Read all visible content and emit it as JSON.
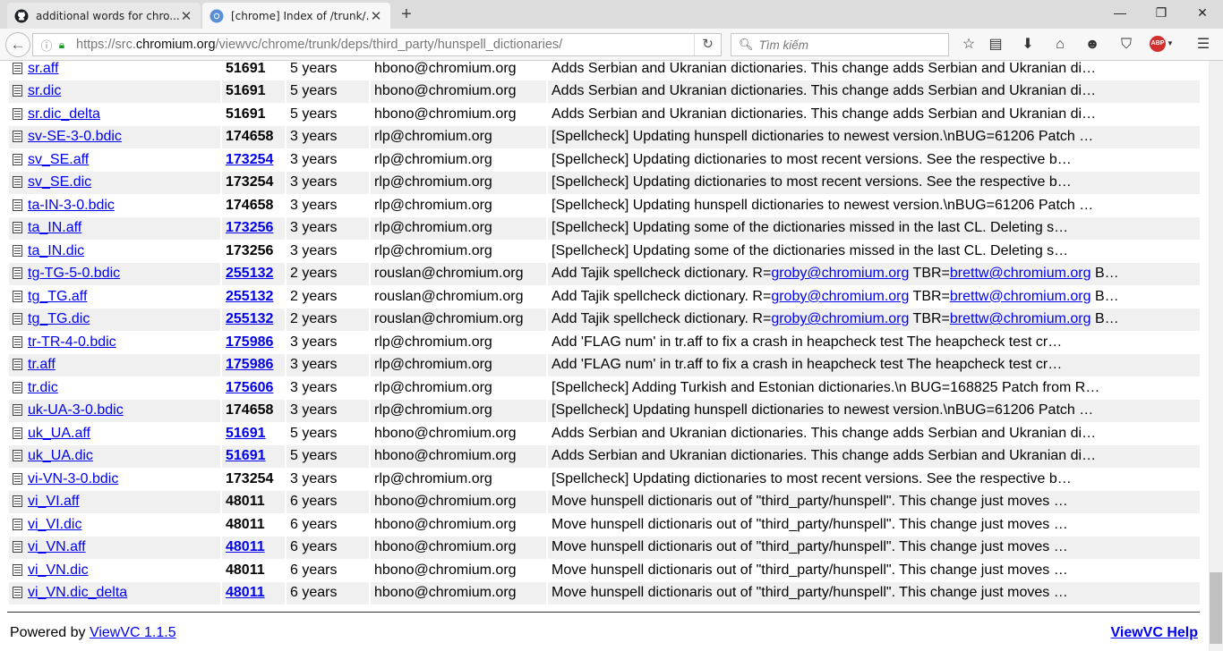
{
  "tabs": [
    {
      "title": "additional words for chro..."
    },
    {
      "title": "[chrome] Index of /trunk/..."
    }
  ],
  "navbar": {
    "url_prefix": "https://src.",
    "url_domain": "chromium.org",
    "url_path": "/viewvc/chrome/trunk/deps/third_party/hunspell_dictionaries/",
    "search_placeholder": "Tìm kiếm",
    "adblock_label": "ABP"
  },
  "colors": {
    "link": "#0000ee",
    "row_alt": "#f0f0f0",
    "secure_lock": "#1a9a2c",
    "adblock": "#d32f2f"
  },
  "rows": [
    {
      "name": "sr.aff",
      "rev": "51691",
      "rev_link": false,
      "age": "5 years",
      "author": "hbono@chromium.org",
      "log": "Adds Serbian and Ukranian dictionaries. This change adds Serbian and Ukranian di…"
    },
    {
      "name": "sr.dic",
      "rev": "51691",
      "rev_link": false,
      "age": "5 years",
      "author": "hbono@chromium.org",
      "log": "Adds Serbian and Ukranian dictionaries. This change adds Serbian and Ukranian di…"
    },
    {
      "name": "sr.dic_delta",
      "rev": "51691",
      "rev_link": false,
      "age": "5 years",
      "author": "hbono@chromium.org",
      "log": "Adds Serbian and Ukranian dictionaries. This change adds Serbian and Ukranian di…"
    },
    {
      "name": "sv-SE-3-0.bdic",
      "rev": "174658",
      "rev_link": false,
      "age": "3 years",
      "author": "rlp@chromium.org",
      "log": "[Spellcheck] Updating hunspell dictionaries to newest version.\\nBUG=61206 Patch …"
    },
    {
      "name": "sv_SE.aff",
      "rev": "173254",
      "rev_link": true,
      "age": "3 years",
      "author": "rlp@chromium.org",
      "log": "[Spellcheck] Updating dictionaries to most recent versions. See the respective b…"
    },
    {
      "name": "sv_SE.dic",
      "rev": "173254",
      "rev_link": false,
      "age": "3 years",
      "author": "rlp@chromium.org",
      "log": "[Spellcheck] Updating dictionaries to most recent versions. See the respective b…"
    },
    {
      "name": "ta-IN-3-0.bdic",
      "rev": "174658",
      "rev_link": false,
      "age": "3 years",
      "author": "rlp@chromium.org",
      "log": "[Spellcheck] Updating hunspell dictionaries to newest version.\\nBUG=61206 Patch …"
    },
    {
      "name": "ta_IN.aff",
      "rev": "173256",
      "rev_link": true,
      "age": "3 years",
      "author": "rlp@chromium.org",
      "log": "[Spellcheck] Updating some of the dictionaries missed in the last CL. Deleting s…"
    },
    {
      "name": "ta_IN.dic",
      "rev": "173256",
      "rev_link": false,
      "age": "3 years",
      "author": "rlp@chromium.org",
      "log": "[Spellcheck] Updating some of the dictionaries missed in the last CL. Deleting s…"
    },
    {
      "name": "tg-TG-5-0.bdic",
      "rev": "255132",
      "rev_link": true,
      "age": "2 years",
      "author": "rouslan@chromium.org",
      "log_pre": "Add Tajik spellcheck dictionary. R=",
      "log_l1": "groby@chromium.org",
      "log_mid": " TBR=",
      "log_l2": "brettw@chromium.org",
      "log_post": " B…"
    },
    {
      "name": "tg_TG.aff",
      "rev": "255132",
      "rev_link": true,
      "age": "2 years",
      "author": "rouslan@chromium.org",
      "log_pre": "Add Tajik spellcheck dictionary. R=",
      "log_l1": "groby@chromium.org",
      "log_mid": " TBR=",
      "log_l2": "brettw@chromium.org",
      "log_post": " B…"
    },
    {
      "name": "tg_TG.dic",
      "rev": "255132",
      "rev_link": true,
      "age": "2 years",
      "author": "rouslan@chromium.org",
      "log_pre": "Add Tajik spellcheck dictionary. R=",
      "log_l1": "groby@chromium.org",
      "log_mid": " TBR=",
      "log_l2": "brettw@chromium.org",
      "log_post": " B…"
    },
    {
      "name": "tr-TR-4-0.bdic",
      "rev": "175986",
      "rev_link": true,
      "age": "3 years",
      "author": "rlp@chromium.org",
      "log": "Add 'FLAG num' in tr.aff to fix a crash in heapcheck test The heapcheck test cr…"
    },
    {
      "name": "tr.aff",
      "rev": "175986",
      "rev_link": true,
      "age": "3 years",
      "author": "rlp@chromium.org",
      "log": "Add 'FLAG num' in tr.aff to fix a crash in heapcheck test The heapcheck test cr…"
    },
    {
      "name": "tr.dic",
      "rev": "175606",
      "rev_link": true,
      "age": "3 years",
      "author": "rlp@chromium.org",
      "log": "[Spellcheck] Adding Turkish and Estonian dictionaries.\\n BUG=168825 Patch from R…"
    },
    {
      "name": "uk-UA-3-0.bdic",
      "rev": "174658",
      "rev_link": false,
      "age": "3 years",
      "author": "rlp@chromium.org",
      "log": "[Spellcheck] Updating hunspell dictionaries to newest version.\\nBUG=61206 Patch …"
    },
    {
      "name": "uk_UA.aff",
      "rev": "51691",
      "rev_link": true,
      "age": "5 years",
      "author": "hbono@chromium.org",
      "log": "Adds Serbian and Ukranian dictionaries. This change adds Serbian and Ukranian di…"
    },
    {
      "name": "uk_UA.dic",
      "rev": "51691",
      "rev_link": true,
      "age": "5 years",
      "author": "hbono@chromium.org",
      "log": "Adds Serbian and Ukranian dictionaries. This change adds Serbian and Ukranian di…"
    },
    {
      "name": "vi-VN-3-0.bdic",
      "rev": "173254",
      "rev_link": false,
      "age": "3 years",
      "author": "rlp@chromium.org",
      "log": "[Spellcheck] Updating dictionaries to most recent versions. See the respective b…"
    },
    {
      "name": "vi_VI.aff",
      "rev": "48011",
      "rev_link": false,
      "age": "6 years",
      "author": "hbono@chromium.org",
      "log": "Move hunspell dictionaris out of \"third_party/hunspell\". This change just moves …"
    },
    {
      "name": "vi_VI.dic",
      "rev": "48011",
      "rev_link": false,
      "age": "6 years",
      "author": "hbono@chromium.org",
      "log": "Move hunspell dictionaris out of \"third_party/hunspell\". This change just moves …"
    },
    {
      "name": "vi_VN.aff",
      "rev": "48011",
      "rev_link": true,
      "age": "6 years",
      "author": "hbono@chromium.org",
      "log": "Move hunspell dictionaris out of \"third_party/hunspell\". This change just moves …"
    },
    {
      "name": "vi_VN.dic",
      "rev": "48011",
      "rev_link": false,
      "age": "6 years",
      "author": "hbono@chromium.org",
      "log": "Move hunspell dictionaris out of \"third_party/hunspell\". This change just moves …"
    },
    {
      "name": "vi_VN.dic_delta",
      "rev": "48011",
      "rev_link": true,
      "age": "6 years",
      "author": "hbono@chromium.org",
      "log": "Move hunspell dictionaris out of \"third_party/hunspell\". This change just moves …"
    }
  ],
  "footer": {
    "powered_by": "Powered by ",
    "viewvc_link": "ViewVC 1.1.5",
    "help_link": "ViewVC Help"
  }
}
